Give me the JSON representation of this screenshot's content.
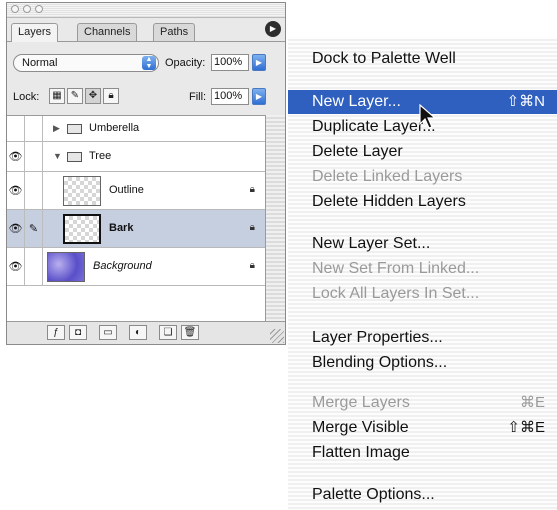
{
  "palette": {
    "tabs": [
      "Layers",
      "Channels",
      "Paths"
    ],
    "blend_mode": "Normal",
    "opacity_label": "Opacity:",
    "opacity_value": "100%",
    "lock_label": "Lock:",
    "fill_label": "Fill:",
    "fill_value": "100%",
    "layers": [
      {
        "name": "Umberella",
        "type": "set",
        "expanded": false,
        "visible": false
      },
      {
        "name": "Tree",
        "type": "set",
        "expanded": true,
        "visible": true
      },
      {
        "name": "Outline",
        "type": "layer",
        "visible": true,
        "locked": true
      },
      {
        "name": "Bark",
        "type": "layer",
        "visible": true,
        "locked": true,
        "selected": true,
        "brush": true
      },
      {
        "name": "Background",
        "type": "layer",
        "visible": true,
        "locked": true,
        "italic": true
      }
    ]
  },
  "menu": {
    "items": [
      {
        "label": "Dock to Palette Well",
        "enabled": true
      },
      {
        "label": "New Layer...",
        "enabled": true,
        "highlight": true,
        "shortcut": "⇧⌘N"
      },
      {
        "label": "Duplicate Layer...",
        "enabled": true
      },
      {
        "label": "Delete Layer",
        "enabled": true
      },
      {
        "label": "Delete Linked Layers",
        "enabled": false
      },
      {
        "label": "Delete Hidden Layers",
        "enabled": true
      },
      {
        "label": "New Layer Set...",
        "enabled": true
      },
      {
        "label": "New Set From Linked...",
        "enabled": false
      },
      {
        "label": "Lock All Layers In Set...",
        "enabled": false
      },
      {
        "label": "Layer Properties...",
        "enabled": true
      },
      {
        "label": "Blending Options...",
        "enabled": true
      },
      {
        "label": "Merge Layers",
        "enabled": false,
        "shortcut": "⌘E"
      },
      {
        "label": "Merge Visible",
        "enabled": true,
        "shortcut": "⇧⌘E"
      },
      {
        "label": "Flatten Image",
        "enabled": true
      },
      {
        "label": "Palette Options...",
        "enabled": true
      }
    ]
  },
  "colors": {
    "highlight": "#2f5fbf",
    "selected_row": "#c6cfe0"
  }
}
